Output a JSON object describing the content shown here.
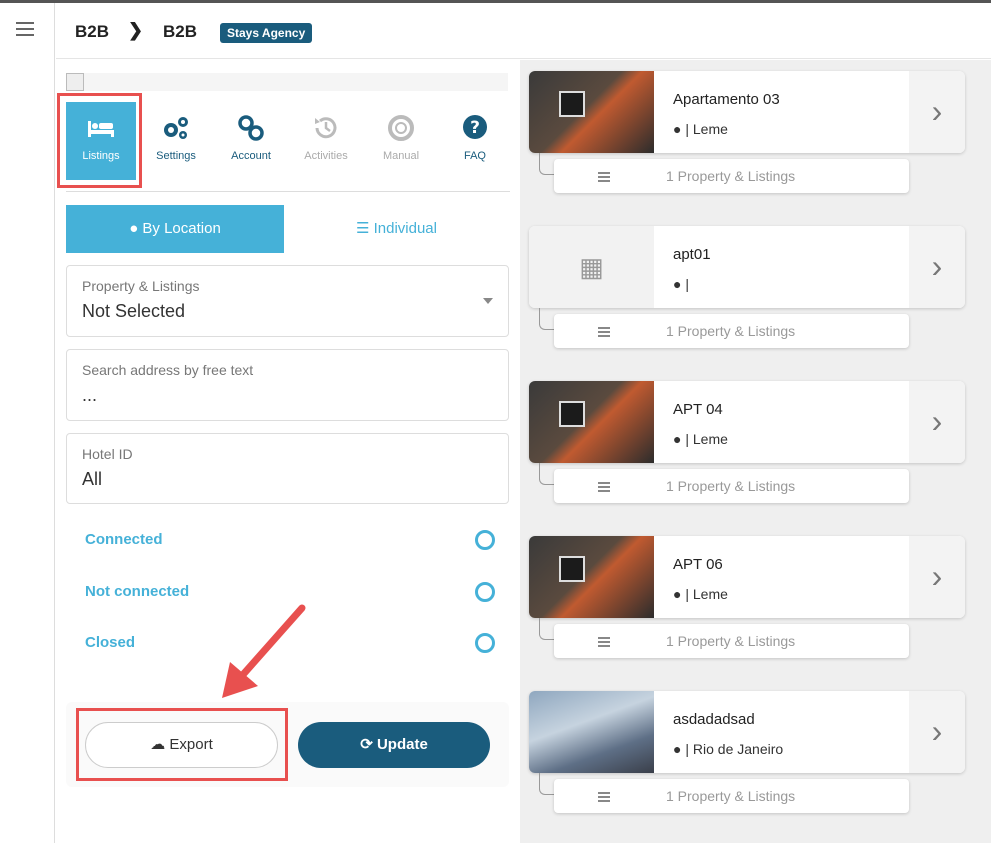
{
  "header": {
    "crumb1": "B2B",
    "crumb2": "B2B",
    "sep": "❯",
    "agency": "Stays Agency"
  },
  "tabs": [
    {
      "label": "Listings",
      "icon": "bed-icon",
      "glyph": "🛏",
      "state": "active"
    },
    {
      "label": "Settings",
      "icon": "cogs-icon",
      "glyph": "⚙",
      "state": "normal"
    },
    {
      "label": "Account",
      "icon": "link-icon",
      "glyph": "🔗",
      "state": "normal"
    },
    {
      "label": "Activities",
      "icon": "history-icon",
      "glyph": "↺",
      "state": "disabled"
    },
    {
      "label": "Manual",
      "icon": "lifebuoy-icon",
      "glyph": "◎",
      "state": "disabled"
    },
    {
      "label": "FAQ",
      "icon": "question-icon",
      "glyph": "?",
      "state": "normal"
    }
  ],
  "segment": {
    "by_location": "By Location",
    "individual": "Individual"
  },
  "fields": {
    "property": {
      "label": "Property & Listings",
      "value": "Not Selected"
    },
    "search": {
      "label": "Search address by free text",
      "value": "..."
    },
    "hotel": {
      "label": "Hotel ID",
      "value": "All"
    }
  },
  "statuses": [
    "Connected",
    "Not connected",
    "Closed"
  ],
  "actions": {
    "export": "Export",
    "update": "Update"
  },
  "listings": [
    {
      "name": "Apartamento 03",
      "location": "| Leme",
      "image": "room",
      "sub": "1 Property & Listings"
    },
    {
      "name": "apt01",
      "location": "|",
      "image": "building",
      "sub": "1 Property & Listings"
    },
    {
      "name": "APT 04",
      "location": "| Leme",
      "image": "room",
      "sub": "1 Property & Listings"
    },
    {
      "name": "APT 06",
      "location": "| Leme",
      "image": "room",
      "sub": "1 Property & Listings"
    },
    {
      "name": "asdadadsad",
      "location": "| Rio de Janeiro",
      "image": "porch",
      "sub": "1 Property & Listings"
    }
  ],
  "colors": {
    "accent": "#45b1d8",
    "primary": "#1a5c7d",
    "highlight": "#e8504f"
  }
}
